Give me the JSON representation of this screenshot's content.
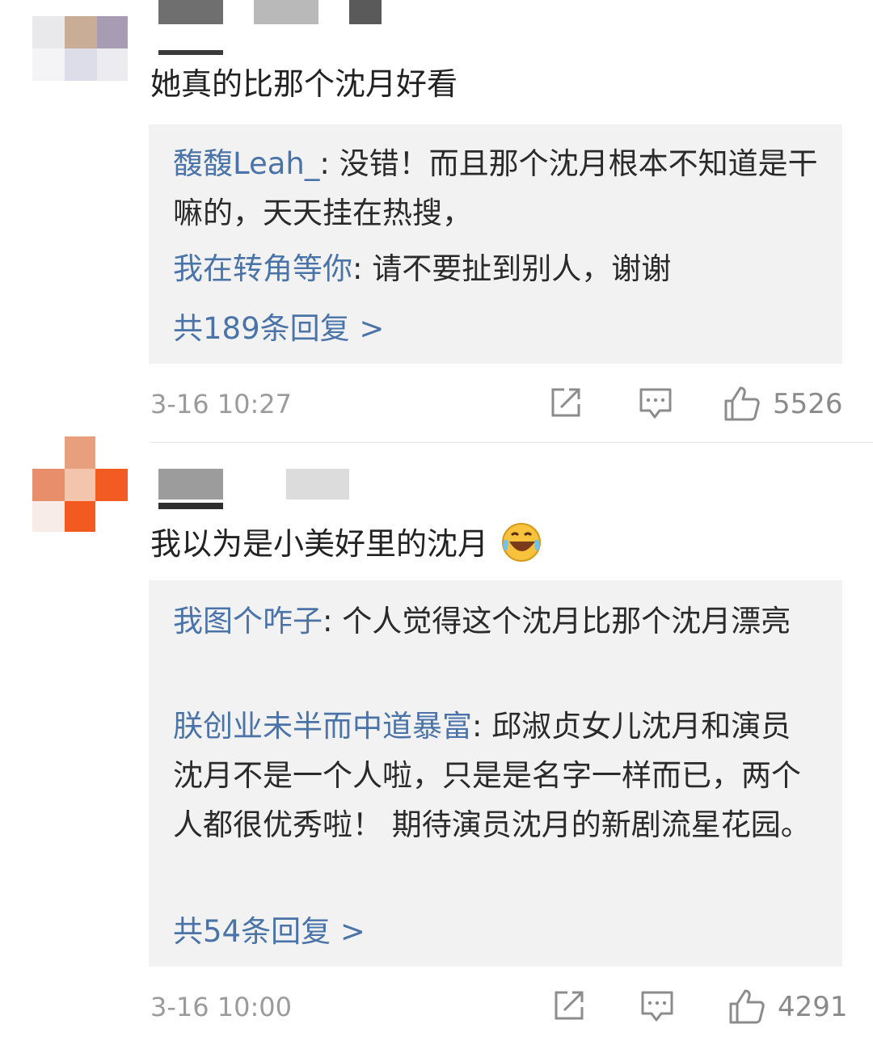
{
  "comments": [
    {
      "text": "她真的比那个沈月好看",
      "replies": [
        {
          "user": "馥馥Leah_",
          "content": ": 没错！而且那个沈月根本不知道是干嘛的，天天挂在热搜，"
        },
        {
          "user": "我在转角等你",
          "content": ": 请不要扯到别人，谢谢"
        }
      ],
      "more_label": "共189条回复 >",
      "date": "3-16 10:27",
      "likes": "5526",
      "icons": [
        "share-icon",
        "comment-icon",
        "like-icon"
      ],
      "emoji": ""
    },
    {
      "text": "我以为是小美好里的沈月",
      "emoji": "laughing-crying-face",
      "replies": [
        {
          "user": "我图个咋子",
          "content": ": 个人觉得这个沈月比那个沈月漂亮"
        },
        {
          "user": "朕创业未半而中道暴富",
          "content": ": 邱淑贞女儿沈月和演员沈月不是一个人啦，只是是名字一样而已，两个人都很优秀啦！ 期待演员沈月的新剧流星花园。"
        }
      ],
      "more_label": "共54条回复 >",
      "date": "3-16 10:00",
      "likes": "4291",
      "icons": [
        "share-icon",
        "comment-icon",
        "like-icon"
      ]
    }
  ],
  "colors": {
    "username": "#4a74a8",
    "reply_bg": "#f2f2f2",
    "meta_text": "#9b9b9b"
  }
}
